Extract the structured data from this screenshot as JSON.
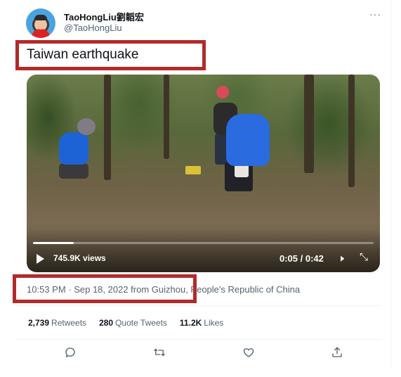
{
  "author": {
    "display_name": "TaoHongLiu劉韜宏",
    "handle": "@TaoHongLiu"
  },
  "tweet": {
    "text": "Taiwan earthquake",
    "timestamp": "10:53 PM · Sep 18, 2022",
    "source": " from Guizhou, People's Republic of China"
  },
  "video": {
    "views": "745.9K views",
    "time": "0:05 / 0:42",
    "progress": 0.12
  },
  "stats": {
    "retweets_count": "2,739",
    "retweets_label": "Retweets",
    "quotes_count": "280",
    "quotes_label": "Quote Tweets",
    "likes_count": "11.2K",
    "likes_label": "Likes"
  },
  "icons": {
    "more": "more-icon",
    "reply": "reply-icon",
    "retweet": "retweet-icon",
    "like": "like-icon",
    "share": "share-icon"
  },
  "colors": {
    "highlight_border": "#b32a2a",
    "secondary_text": "#536471",
    "primary_text": "#0f1419"
  }
}
